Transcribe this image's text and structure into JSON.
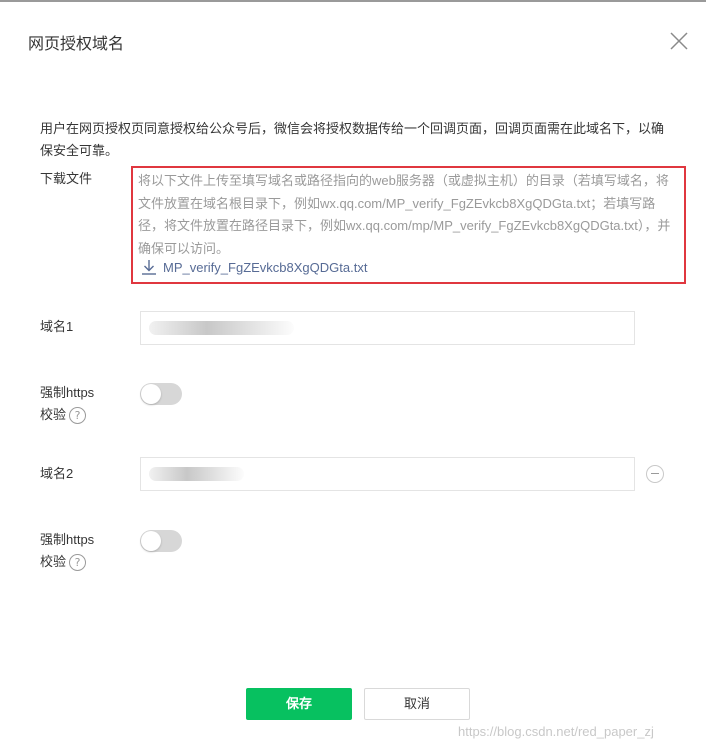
{
  "dialog": {
    "title": "网页授权域名",
    "description": "用户在网页授权页同意授权给公众号后，微信会将授权数据传给一个回调页面，回调页面需在此域名下，以确保安全可靠。"
  },
  "download": {
    "label": "下载文件",
    "instructions": "将以下文件上传至填写域名或路径指向的web服务器（或虚拟主机）的目录（若填写域名，将文件放置在域名根目录下，例如wx.qq.com/MP_verify_FgZEvkcb8XgQDGta.txt；若填写路径，将文件放置在路径目录下，例如wx.qq.com/mp/MP_verify_FgZEvkcb8XgQDGta.txt），并确保可以访问。",
    "file_name": "MP_verify_FgZEvkcb8XgQDGta.txt",
    "icon": "download-icon",
    "highlight_color": "#e0373f"
  },
  "domains": [
    {
      "label": "域名1",
      "https_label_line1": "强制https",
      "https_label_line2": "校验",
      "https_enabled": false
    },
    {
      "label": "域名2",
      "https_label_line1": "强制https",
      "https_label_line2": "校验",
      "https_enabled": false
    }
  ],
  "help_glyph": "?",
  "buttons": {
    "save": "保存",
    "cancel": "取消"
  },
  "watermark": "https://blog.csdn.net/red_paper_zj",
  "colors": {
    "primary": "#07c160",
    "link": "#576b95",
    "toggle_off": "#d7d7d7"
  }
}
